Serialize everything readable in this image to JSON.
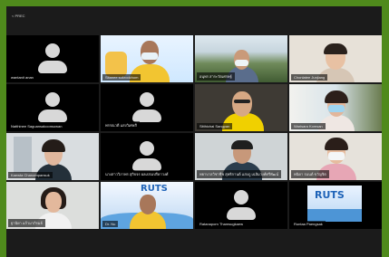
{
  "window": {
    "title": "< PREC"
  },
  "participants": [
    {
      "name": "wantanit anan"
    },
    {
      "name": "Sitanee sukrodchom"
    },
    {
      "name": "อนุพร สาระวัตเศรษฐ์"
    },
    {
      "name": "Chonlatee Junjiang"
    },
    {
      "name": "Natthinee Saguansakoonsuwan"
    },
    {
      "name": "พรรณวดี แสงวิเศษสี"
    },
    {
      "name": "Sitthichai Sangpan"
    },
    {
      "name": "Warisara Komsan"
    },
    {
      "name": "Kaewta Charoenpansuk"
    },
    {
      "name": "นางสาววิภาพร สุกิจจร ผลเปรมปรีดาวงศ์"
    },
    {
      "name": "พยาบาลวิชาชีพ สุทธิกานต์ แสงภู เฉลิมวงศ์ศรีพัฒน์"
    },
    {
      "name": "พนิดา รมนต์ ขวัญจิต"
    },
    {
      "name": "ฐานิยา แก้วมาภิรมย์"
    },
    {
      "name": "Dr. Nu"
    },
    {
      "name": "Ratanaporn Thamsugkaew"
    },
    {
      "name": "Runtaa Paengsak"
    }
  ],
  "logos": {
    "ruts_left": "RUTS",
    "ruts_right": "RUTS"
  },
  "colors": {
    "background": "#4f8a1c",
    "window": "#1b1b1b",
    "active_outline": "#9acd32"
  }
}
